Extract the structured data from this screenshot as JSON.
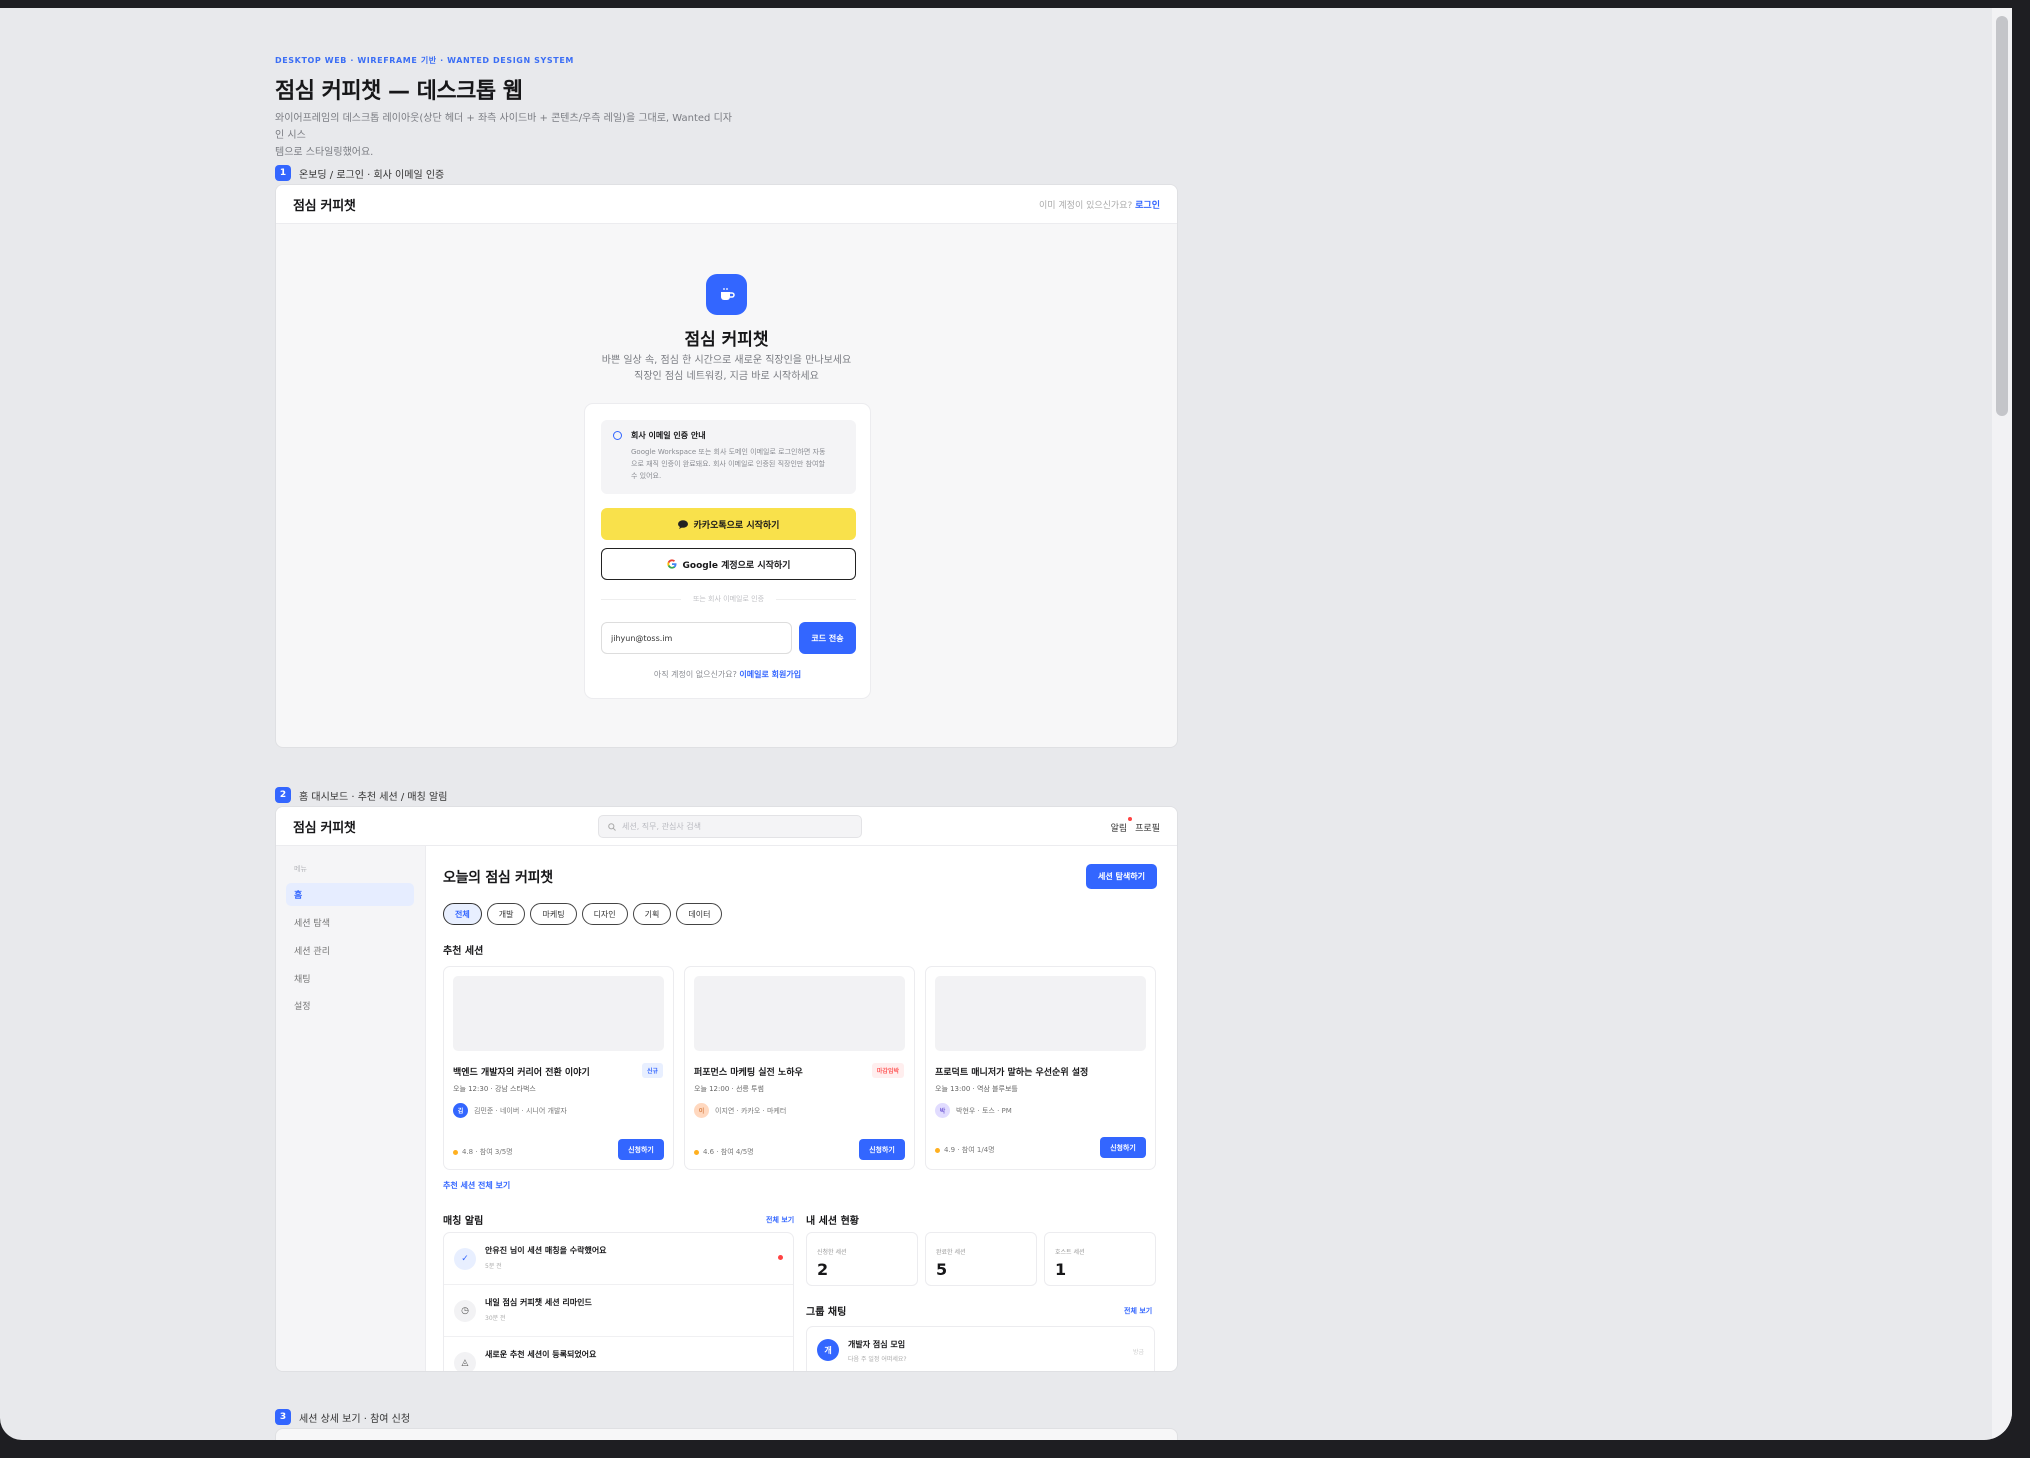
{
  "doc": {
    "eyebrow": "DESKTOP WEB · WIREFRAME 기반 · WANTED DESIGN SYSTEM",
    "title": "점심 커피챗 — 데스크톱 웹",
    "desc_line1": "와이어프레임의 데스크톱 레이아웃(상단 헤더 + 좌측 사이드바 + 콘텐츠/우측 레일)을 그대로, Wanted 디자인 시스",
    "desc_line2": "템으로 스타일링했어요."
  },
  "sections": [
    {
      "num": "1",
      "label": "온보딩 / 로그인 · 회사 이메일 인증"
    },
    {
      "num": "2",
      "label": "홈 대시보드 · 추천 세션 / 매칭 알림"
    },
    {
      "num": "3",
      "label": "세션 상세 보기 · 참여 신청"
    }
  ],
  "brand": "점심 커피챗",
  "onboarding": {
    "header_prompt": "이미 계정이 있으신가요?",
    "header_login": "로그인",
    "title": "점심 커피챗",
    "sub1": "바쁜 일상 속, 점심 한 시간으로 새로운 직장인을 만나보세요",
    "sub2": "직장인 점심 네트워킹, 지금 바로 시작하세요",
    "notice_title": "회사 이메일 인증 안내",
    "notice_l1": "Google Workspace 또는 회사 도메인 이메일로 로그인하면 자동",
    "notice_l2": "으로 재직 인증이 완료돼요. 회사 이메일로 인증된 직장인만 참여할",
    "notice_l3": "수 있어요.",
    "kakao": "카카오톡으로 시작하기",
    "google": "Google 계정으로 시작하기",
    "divider": "또는 회사 이메일로 인증",
    "email_value": "jihyun@toss.im",
    "code_btn": "코드 전송",
    "signup_prompt": "아직 계정이 없으신가요?",
    "signup_link": "이메일로 회원가입"
  },
  "dashboard": {
    "search_placeholder": "세션, 직무, 관심사 검색",
    "notif_link": "알림",
    "profile_link": "프로필",
    "side_caption": "메뉴",
    "side_items": [
      "홈",
      "세션 탐색",
      "세션 관리",
      "채팅",
      "설정"
    ],
    "title": "오늘의 점심 커피챗",
    "explore_btn": "세션 탐색하기",
    "chips": [
      "전체",
      "개발",
      "마케팅",
      "디자인",
      "기획",
      "데이터"
    ],
    "rec_heading": "추천 세션",
    "cards": [
      {
        "title": "백엔드 개발자의 커리어 전환 이야기",
        "badge": "신규",
        "meta": "오늘 12:30 · 강남 스타벅스",
        "host_initial": "김",
        "host": "김민준 · 네이버 · 시니어 개발자",
        "rating": "4.8 · 참여 3/5명",
        "apply": "신청하기",
        "av_color": "#3366ff"
      },
      {
        "title": "퍼포먼스 마케팅 실전 노하우",
        "badge": "마감임박",
        "meta": "오늘 12:00 · 선릉 투썸",
        "host_initial": "이",
        "host": "이지연 · 카카오 · 마케터",
        "rating": "4.6 · 참여 4/5명",
        "apply": "신청하기",
        "av_color": "#ffd8bf"
      },
      {
        "title": "프로덕트 매니저가 말하는 우선순위 설정",
        "badge": "",
        "meta": "오늘 13:00 · 역삼 블루보틀",
        "host_initial": "박",
        "host": "박현우 · 토스 · PM",
        "rating": "4.9 · 참여 1/4명",
        "apply": "신청하기",
        "av_color": "#e1dcff"
      }
    ],
    "rec_all": "추천 세션 전체 보기",
    "match_heading": "매칭 알림",
    "match_all": "전체 보기",
    "notifications": [
      {
        "text": "안유진 님이 세션 매칭을 수락했어요",
        "time": "5분 전",
        "icon": "✓"
      },
      {
        "text": "내일 점심 커피챗 세션 리마인드",
        "time": "30분 전",
        "icon": "◷"
      },
      {
        "text": "새로운 추천 세션이 등록되었어요",
        "time": "",
        "icon": "◬"
      }
    ],
    "status_heading": "내 세션 현황",
    "stats": [
      {
        "label": "신청한 세션",
        "value": "2"
      },
      {
        "label": "완료한 세션",
        "value": "5"
      },
      {
        "label": "호스트 세션",
        "value": "1"
      }
    ],
    "group_heading": "그룹 채팅",
    "group_all": "전체 보기",
    "chat": {
      "initial": "개",
      "name": "개발자 점심 모임",
      "last": "다음 주 일정 어떠세요?",
      "time": "방금"
    }
  },
  "colors": {
    "accent": "#3366ff",
    "kakao": "#f9e14b",
    "alert": "#ff4242"
  }
}
